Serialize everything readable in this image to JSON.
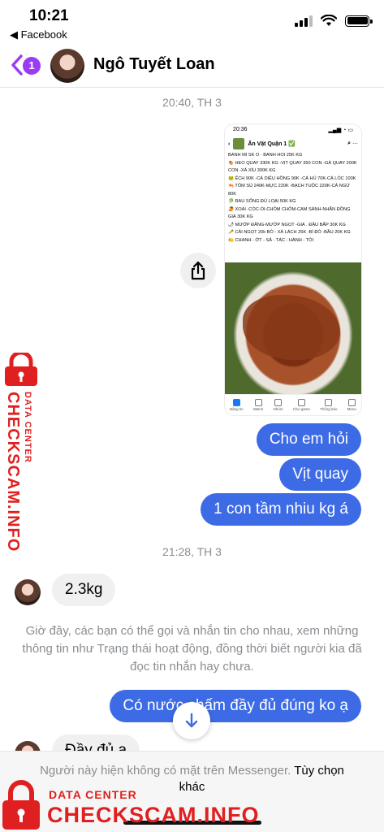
{
  "status_bar": {
    "time": "10:21",
    "back_app": "◀ Facebook"
  },
  "header": {
    "unread_count": "1",
    "contact_name": "Ngô Tuyết Loan"
  },
  "conversation": {
    "timestamp_1": "20:40, TH 3",
    "shared_screenshot": {
      "time": "20:36",
      "page_name": "Ăn Vặt Quận 1 ✅",
      "lines": [
        "BANH MI SK O - BANH HOI 25K KG",
        "🍖 HEO QUAY 330K KG -VỊT QUAY 350 CON -GÀ QUAY 200K CON -XÁ XÍU 300K KG",
        "🐸 ẾCH 90K -CÁ DIÊU HỒNG 90K -CÁ HÚ 70K-CÁ LÓC 100K",
        "🦐 TÔM SÚ 240K-MỰC 220K -BẠCH TUỘC 220K-CÁ NGỪ 80K",
        "🥬 RAU SỐNG ĐỦ LOẠI 50K KG",
        "🥭 XOÀI -CÓC-ỔI-CHÔM CHÔM-CAM SÀNH-NHÃN ĐỒNG GIÁ 30K KG",
        "🌶 MƯỚP ĐẮNG-MƯỚP NGỌT -GIÁ . ĐẬU BẮP 30K KG",
        "🥕 CẢI NGỌT 20k BÓ - XÀ LÁCH 25K -BÍ ĐỎ -BẦU 20K KG",
        "🍋 CHANH - ỚT - SẢ - TÁC - HÀNH - TỎI"
      ],
      "tabs": [
        "Bảng tin",
        "Watch",
        "Nhóm",
        "Chợ game",
        "Thông báo",
        "Menu"
      ]
    },
    "outgoing_1": "Cho em hỏi",
    "outgoing_2": "Vịt quay",
    "outgoing_3": "1 con tầm nhiu kg á",
    "timestamp_2": "21:28, TH 3",
    "incoming_1": "2.3kg",
    "system_note": "Giờ đây, các bạn có thể gọi và nhắn tin cho nhau, xem những thông tin như Trạng thái hoạt động, đồng thời biết người kia đã đọc tin nhắn hay chưa.",
    "outgoing_4": "Có nước chấm đầy đủ đúng ko ạ",
    "incoming_2": "Đầy đủ ạ"
  },
  "footer": {
    "text": "Người này hiện không có mặt trên Messenger.",
    "link": "Tùy chọn khác"
  },
  "watermark": {
    "brand": "CHECKSCAM.INFO",
    "sub": "DATA CENTER"
  },
  "colors": {
    "accent_purple": "#9b3cf5",
    "outgoing_bubble": "#3d6be5",
    "incoming_bubble": "#f0f0f0",
    "watermark_red": "#e02020"
  }
}
